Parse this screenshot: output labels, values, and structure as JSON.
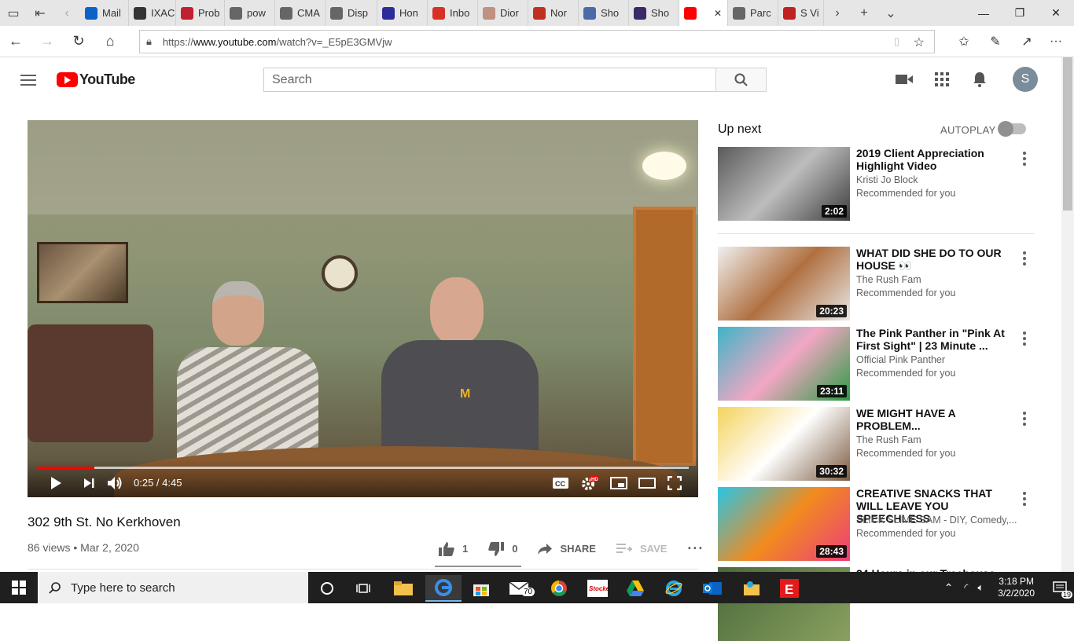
{
  "browser": {
    "tabs": [
      {
        "label": "Mail",
        "color": "#0a64c8"
      },
      {
        "label": "IXAC",
        "color": "#333333"
      },
      {
        "label": "Prob",
        "color": "#c02030"
      },
      {
        "label": "pow",
        "color": "#666666"
      },
      {
        "label": "CMA",
        "color": "#666666"
      },
      {
        "label": "Disp",
        "color": "#666666"
      },
      {
        "label": "Hon",
        "color": "#2c2c9c"
      },
      {
        "label": "Inbo",
        "color": "#d93025"
      },
      {
        "label": "Dior",
        "color": "#c09080"
      },
      {
        "label": "Nor",
        "color": "#c03020"
      },
      {
        "label": "Sho",
        "color": "#4a6aa8"
      },
      {
        "label": "Sho",
        "color": "#3a2a6a"
      },
      {
        "label": "",
        "color": "#ff0000"
      },
      {
        "label": "Parc",
        "color": "#666666"
      },
      {
        "label": "S Vi",
        "color": "#c02020"
      }
    ],
    "url_prefix": "https://",
    "url_host": "www.youtube.com",
    "url_path": "/watch?v=_E5pE3GMVjw"
  },
  "youtube": {
    "logo_text": "YouTube",
    "search_placeholder": "Search",
    "avatar_letter": "S"
  },
  "video": {
    "title": "302 9th St. No Kerkhoven",
    "views": "86 views",
    "date": "Mar 2, 2020",
    "time_display": "0:25 / 4:45",
    "progress_fraction": 0.0877,
    "likes": "1",
    "dislikes": "0",
    "share_label": "SHARE",
    "save_label": "SAVE"
  },
  "sidebar": {
    "up_next_label": "Up next",
    "autoplay_label": "AUTOPLAY",
    "recommendations": [
      {
        "title": "2019 Client Appreciation Highlight Video",
        "channel": "Kristi Jo Block",
        "meta": "Recommended for you",
        "duration": "2:02",
        "thumb": "linear-gradient(135deg,#5a5a5a,#bdbdbd,#3c3c3c)"
      },
      {
        "title": "WHAT DID SHE DO TO OUR HOUSE 👀",
        "channel": "The Rush Fam",
        "meta": "Recommended for you",
        "duration": "20:23",
        "thumb": "linear-gradient(135deg,#f0f0f0,#b07040,#e8e8e8)"
      },
      {
        "title": "The Pink Panther in \"Pink At First Sight\" | 23 Minute ...",
        "channel": "Official Pink Panther",
        "meta": "Recommended for you",
        "duration": "23:11",
        "thumb": "linear-gradient(135deg,#3fb4c8,#f3a7c4,#2a9c44)"
      },
      {
        "title": "WE MIGHT HAVE A PROBLEM...",
        "channel": "The Rush Fam",
        "meta": "Recommended for you",
        "duration": "30:32",
        "thumb": "linear-gradient(135deg,#f4d35e,#ffffff,#7a5a40)"
      },
      {
        "title": "CREATIVE SNACKS THAT WILL LEAVE YOU SPEECHLESS",
        "channel": "SLICK SLIME SAM - DIY, Comedy,...",
        "meta": "Recommended for you",
        "duration": "28:43",
        "thumb": "linear-gradient(135deg,#29c5e6,#f28b1e,#ec3d7a)"
      },
      {
        "title": "24 Hours in our Treehouse",
        "channel": "",
        "meta": "",
        "duration": "",
        "thumb": "linear-gradient(135deg,#4a6a3a,#8aa060)"
      }
    ]
  },
  "taskbar": {
    "search_placeholder": "Type here to search",
    "mail_badge": "70",
    "time": "3:18 PM",
    "date": "3/2/2020",
    "notification_count": "19"
  }
}
